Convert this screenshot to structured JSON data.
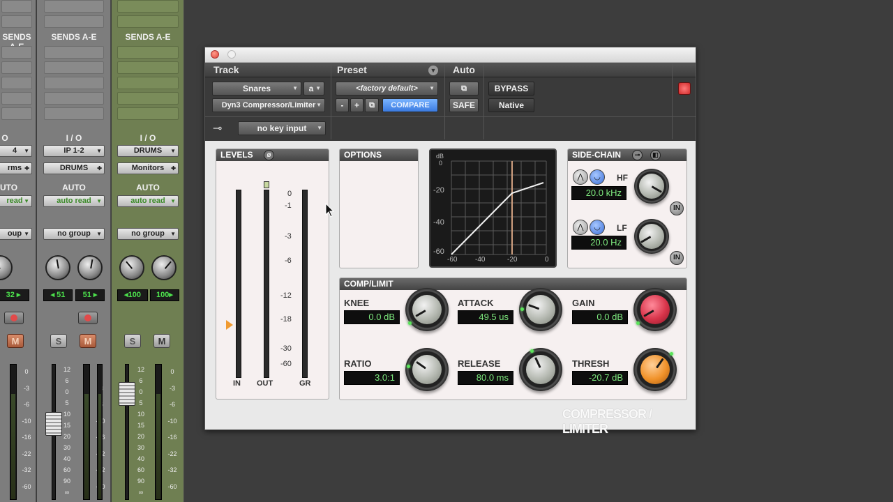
{
  "mixer": {
    "strips": [
      {
        "sends_label": "SENDS A-E",
        "io_label": "O",
        "output": "4",
        "monitor": "rms",
        "auto_label": "UTO",
        "auto_mode": "read",
        "group": "oup",
        "pan_right": "32"
      },
      {
        "sends_label": "SENDS A-E",
        "io_label": "I / O",
        "output": "IP 1-2",
        "monitor": "DRUMS",
        "auto_label": "AUTO",
        "auto_mode": "auto read",
        "group": "no group",
        "pan_left": "51",
        "pan_right": "51",
        "solo": "S",
        "mute": "M"
      },
      {
        "sends_label": "SENDS A-E",
        "io_label": "I / O",
        "output": "DRUMS",
        "monitor": "Monitors",
        "auto_label": "AUTO",
        "auto_mode": "auto read",
        "group": "no group",
        "pan_left": "100",
        "pan_right": "100",
        "solo": "S",
        "mute": "M"
      }
    ],
    "meter_scale": [
      "0",
      "-3",
      "-6",
      "-10",
      "-16",
      "-22",
      "-32",
      "-60"
    ],
    "fader_scale": [
      "12",
      "6",
      "0",
      "5",
      "10",
      "15",
      "20",
      "30",
      "40",
      "60",
      "90",
      "∞"
    ],
    "first_mute": "M"
  },
  "plugin": {
    "track_label": "Track",
    "preset_label": "Preset",
    "auto_label": "Auto",
    "track_name": "Snares",
    "track_channel": "a",
    "plugin_name": "Dyn3 Compressor/Limiter",
    "preset_name": "<factory default>",
    "minus": "-",
    "plus": "+",
    "compare": "COMPARE",
    "safe": "SAFE",
    "bypass": "BYPASS",
    "native": "Native",
    "key_input": "no key input",
    "levels_title": "LEVELS",
    "options_title": "OPTIONS",
    "sidechain_title": "SIDE-CHAIN",
    "comp_title": "COMP/LIMIT",
    "level_ticks": [
      "0",
      "-1",
      "-3",
      "-6",
      "-12",
      "-18",
      "-30",
      "-60"
    ],
    "meter_labels": {
      "in": "IN",
      "out": "OUT",
      "gr": "GR"
    },
    "graph_db": "dB",
    "graph_y": [
      "0",
      "-20",
      "-40",
      "-60"
    ],
    "graph_x": [
      "-60",
      "-40",
      "-20",
      "0"
    ],
    "sidechain": {
      "hf_label": "HF",
      "hf_value": "20.0 kHz",
      "lf_label": "LF",
      "lf_value": "20.0 Hz",
      "in_label": "IN"
    },
    "params": {
      "knee": {
        "label": "KNEE",
        "value": "0.0 dB"
      },
      "attack": {
        "label": "ATTACK",
        "value": "49.5 us"
      },
      "gain": {
        "label": "GAIN",
        "value": "0.0 dB"
      },
      "ratio": {
        "label": "RATIO",
        "value": "3.0:1"
      },
      "release": {
        "label": "RELEASE",
        "value": "80.0 ms"
      },
      "thresh": {
        "label": "THRESH",
        "value": "-20.7 dB"
      }
    },
    "brand": "COMPRESSOR / LIMITER"
  },
  "colors": {
    "accent_green": "#4ce04c",
    "display_green": "#7eea7e",
    "gain_knob": "#d8344a",
    "thresh_knob": "#f0922a",
    "compare_blue": "#5a9af0",
    "bypass_red": "#e04848"
  }
}
